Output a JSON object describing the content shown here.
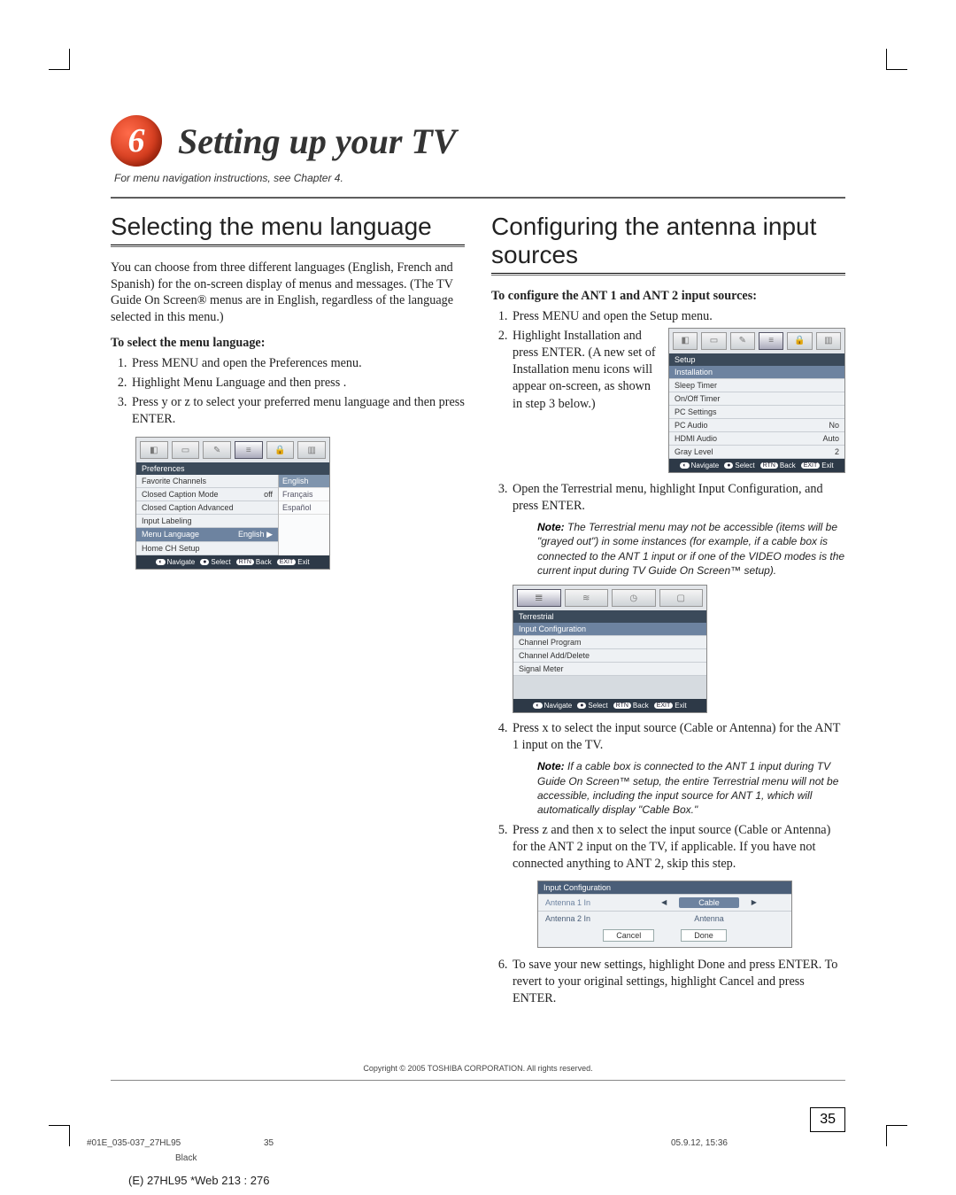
{
  "chapter": {
    "number": "6",
    "title": "Setting up your TV"
  },
  "chapter_sub": "For menu navigation instructions, see Chapter 4.",
  "left": {
    "heading": "Selecting the menu language",
    "intro": "You can choose from three different languages (English, French and Spanish) for the on-screen display of menus and messages. (The TV Guide On Screen® menus are in English, regardless of the language selected in this menu.)",
    "proc_title": "To select the menu language:",
    "steps": [
      "Press MENU and open the Preferences menu.",
      "Highlight Menu Language and then press  .",
      "Press y or z to select your preferred menu language and then press ENTER."
    ]
  },
  "right": {
    "heading": "Configuring the antenna input sources",
    "proc_title": "To configure the ANT 1 and ANT 2 input sources:",
    "step1": "Press MENU and open the Setup menu.",
    "step2": "Highlight Installation and press ENTER. (A new set of Installation menu icons will appear on-screen, as shown in step 3 below.)",
    "step3": "Open the Terrestrial menu, highlight Input Configuration, and press ENTER.",
    "note3": "The Terrestrial menu may not be accessible (items will be \"grayed out\") in some instances (for example, if a cable box is connected to the ANT 1 input or if one of the VIDEO modes is the current input during TV Guide On Screen™ setup).",
    "step4": "Press x     to select the input source (Cable or Antenna) for the ANT 1 input on the TV.",
    "note4": "If a cable box is connected to the ANT 1 input during TV Guide On Screen™ setup, the entire Terrestrial menu will not be accessible, including the input source for ANT 1, which will automatically display \"Cable Box.\"",
    "step5": "Press z and then x     to select the input source (Cable or Antenna) for the ANT 2 input on the TV, if applicable. If you have not connected anything to ANT 2, skip this step.",
    "step6": "To save your new settings, highlight Done and press ENTER. To revert to your original settings, highlight Cancel and press ENTER."
  },
  "osd_pref": {
    "title": "Preferences",
    "rows": [
      {
        "label": "Favorite Channels",
        "value": ""
      },
      {
        "label": "Closed Caption Mode",
        "value": "off"
      },
      {
        "label": "Closed Caption Advanced",
        "value": ""
      },
      {
        "label": "Input Labeling",
        "value": ""
      },
      {
        "label": "Menu Language",
        "value": "English ▶",
        "selected": true
      },
      {
        "label": "Home CH Setup",
        "value": ""
      }
    ],
    "side": [
      {
        "label": "English",
        "selected": true
      },
      {
        "label": "Français"
      },
      {
        "label": "Español"
      }
    ],
    "legend": {
      "nav": "Navigate",
      "sel": "Select",
      "back": "Back",
      "exit": "Exit",
      "rtn": "RTN",
      "exitkey": "EXIT"
    }
  },
  "osd_setup": {
    "title": "Setup",
    "rows": [
      {
        "label": "Installation",
        "value": "",
        "selected": true
      },
      {
        "label": "Sleep Timer",
        "value": ""
      },
      {
        "label": "On/Off Timer",
        "value": ""
      },
      {
        "label": "PC Settings",
        "value": ""
      },
      {
        "label": "PC Audio",
        "value": "No"
      },
      {
        "label": "HDMI Audio",
        "value": "Auto"
      },
      {
        "label": "Gray Level",
        "value": "2"
      }
    ]
  },
  "osd_terr": {
    "title": "Terrestrial",
    "rows": [
      {
        "label": "Input Configuration",
        "selected": true
      },
      {
        "label": "Channel Program"
      },
      {
        "label": "Channel Add/Delete"
      },
      {
        "label": "Signal Meter"
      }
    ]
  },
  "osd_inputconf": {
    "title": "Input Configuration",
    "rows": [
      {
        "label": "Antenna 1 In",
        "value": "Cable",
        "selected": true
      },
      {
        "label": "Antenna 2 In",
        "value": "Antenna"
      }
    ],
    "cancel": "Cancel",
    "done": "Done"
  },
  "note_label": "Note:",
  "footer": {
    "copyright": "Copyright © 2005 TOSHIBA CORPORATION. All rights reserved.",
    "page_number": "35",
    "prepress_file": "#01E_035-037_27HL95",
    "prepress_page": "35",
    "prepress_date": "05.9.12, 15:36",
    "prepress_color": "Black",
    "webline": "(E) 27HL95 *Web 213 : 276"
  }
}
